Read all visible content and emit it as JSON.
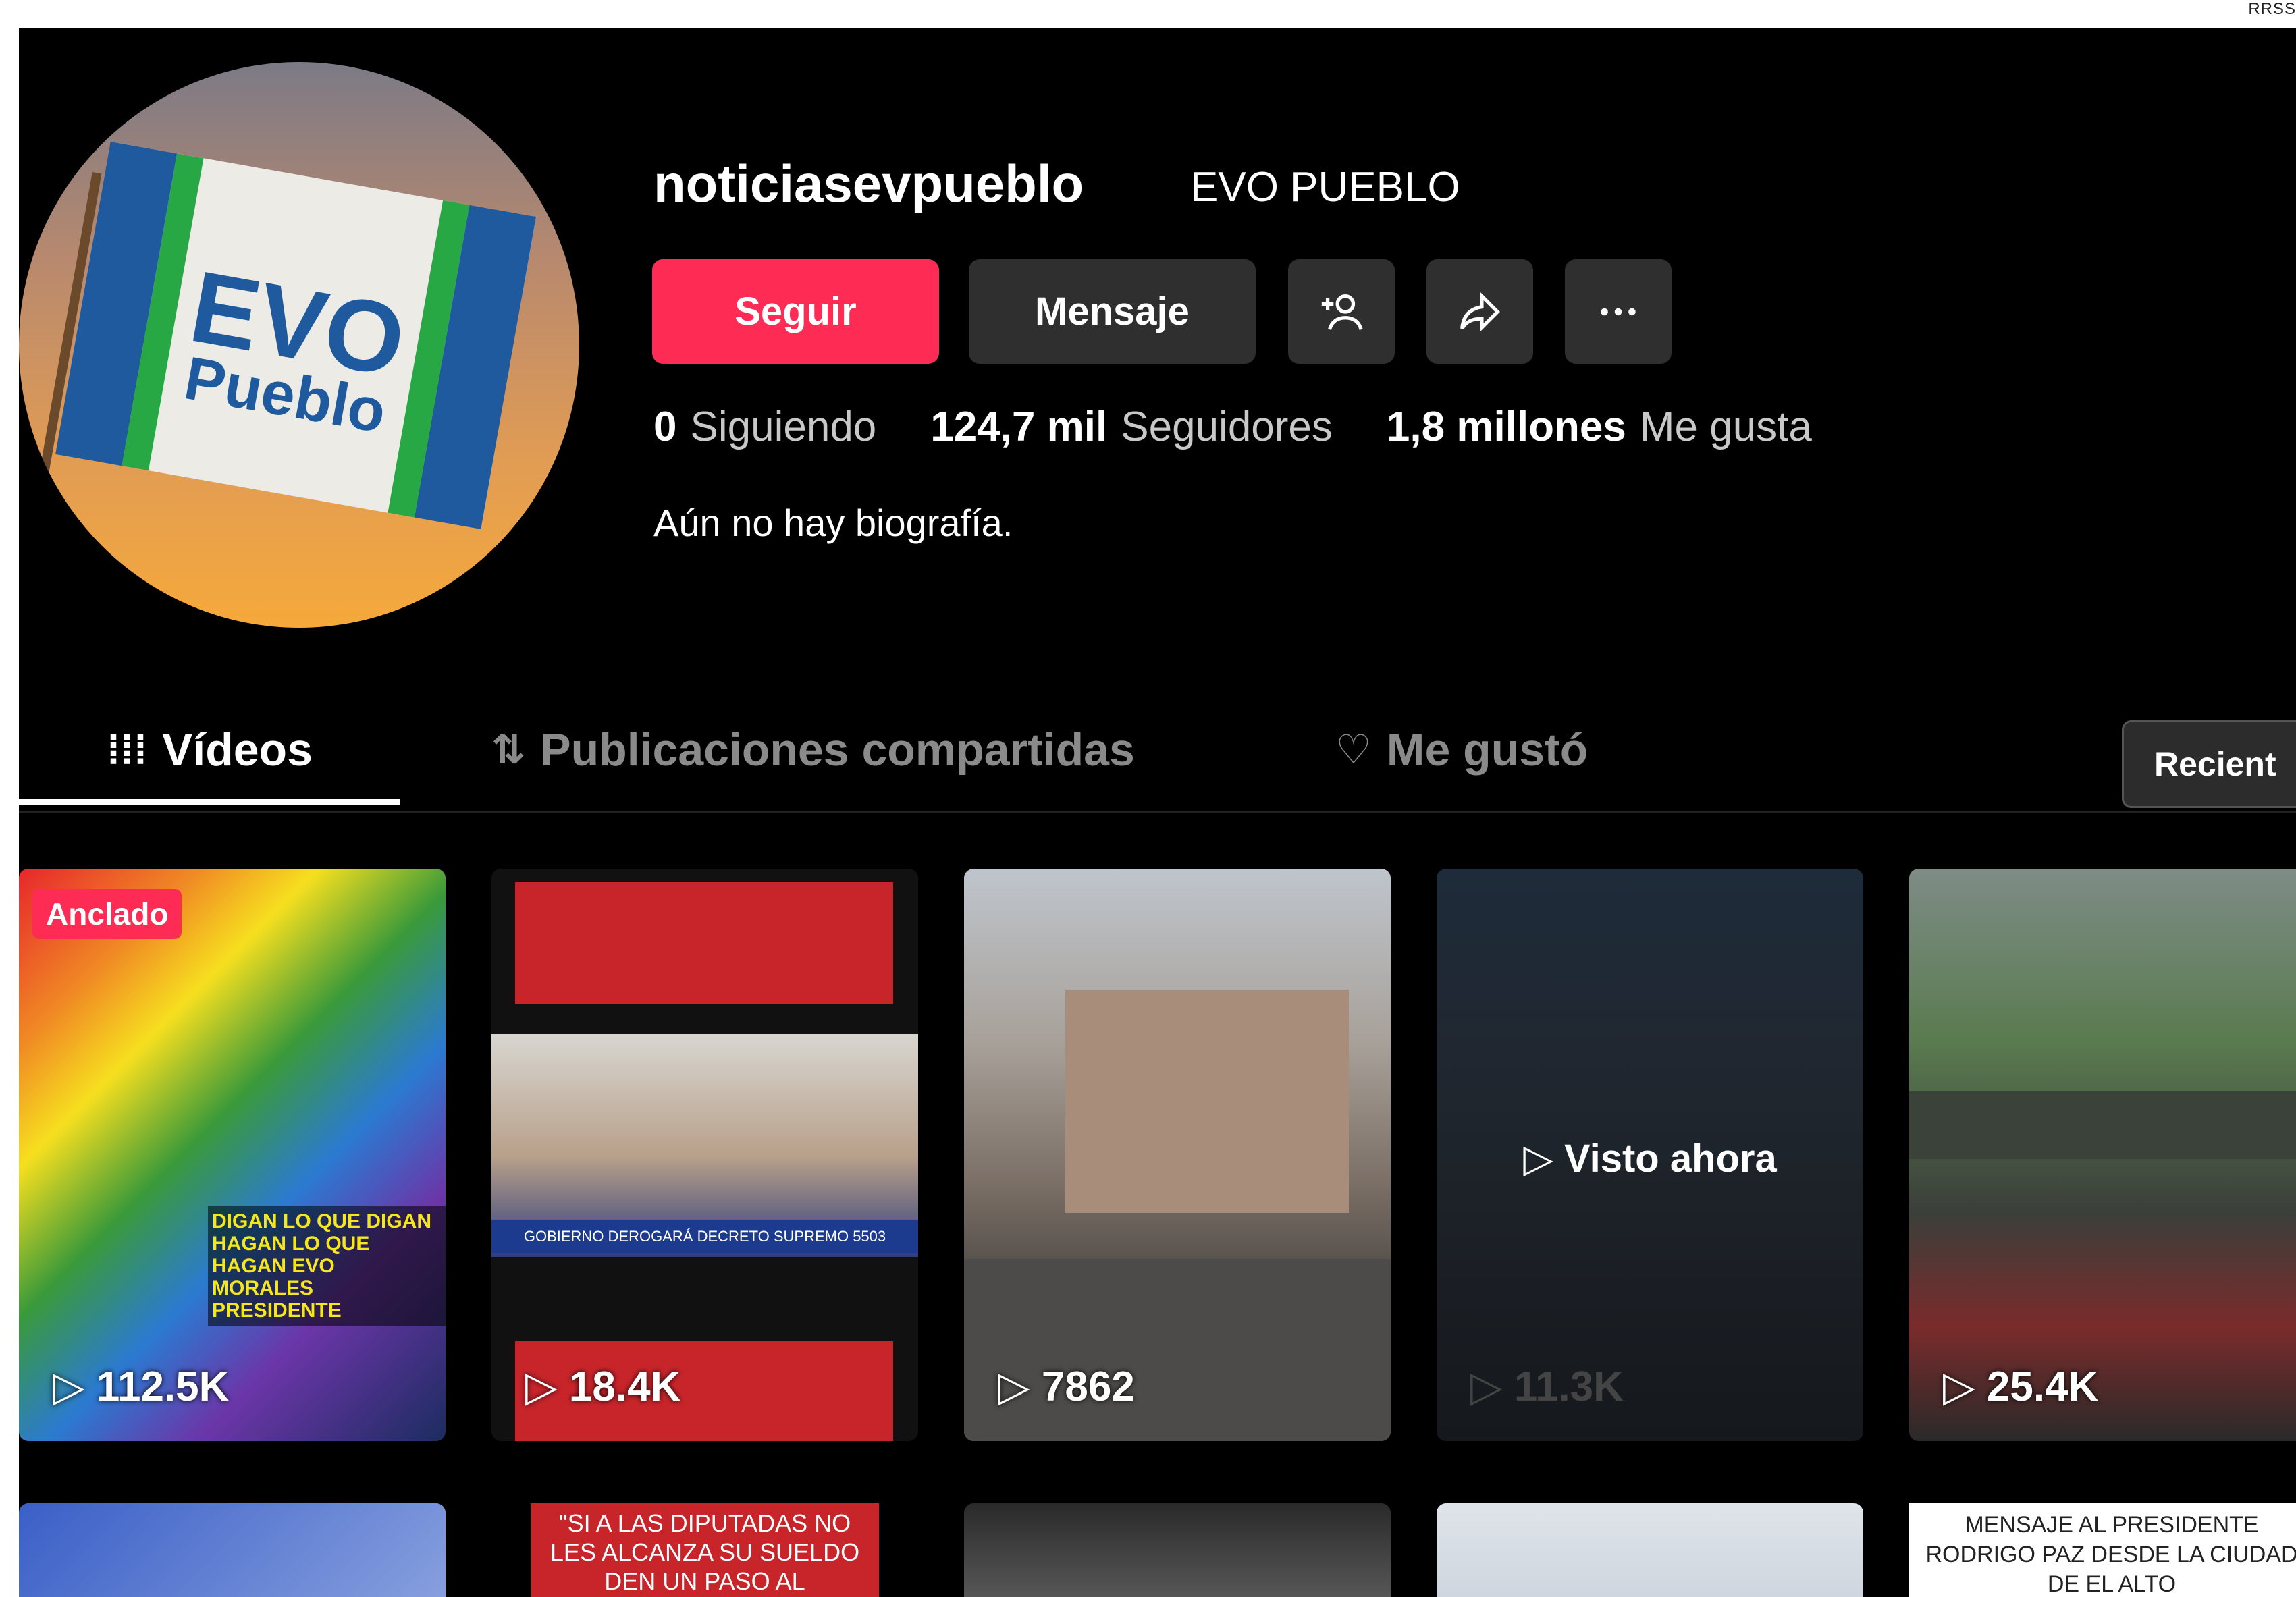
{
  "corner_label": "RRSS",
  "profile": {
    "username": "noticiasevpueblo",
    "nickname": "EVO PUEBLO",
    "avatar_text_1": "EVO",
    "avatar_text_2": "Pueblo",
    "follow_label": "Seguir",
    "message_label": "Mensaje",
    "stats": {
      "following_count": "0",
      "following_label": "Siguiendo",
      "followers_count": "124,7 mil",
      "followers_label": "Seguidores",
      "likes_count": "1,8 millones",
      "likes_label": "Me gusta"
    },
    "bio": "Aún no hay biografía."
  },
  "tabs": {
    "videos": "Vídeos",
    "shared": "Publicaciones compartidas",
    "liked": "Me gustó",
    "sort": "Recient"
  },
  "videos": [
    {
      "badge": "Anclado",
      "views": "112.5K",
      "overlay": "DIGAN LO QUE DIGAN HAGAN LO QUE HAGAN EVO MORALES PRESIDENTE"
    },
    {
      "views": "18.4K",
      "tv_caption": "GOBIERNO DEROGARÁ DECRETO SUPREMO 5503"
    },
    {
      "views": "7862"
    },
    {
      "views": "11.3K",
      "watched": "Visto ahora"
    },
    {
      "views": "25.4K"
    }
  ],
  "row2": {
    "card2_text": "\"SI A LAS DIPUTADAS NO LES ALCANZA SU SUELDO DEN UN PASO AL",
    "card5_text": "MENSAJE AL PRESIDENTE RODRIGO PAZ DESDE LA CIUDAD DE EL ALTO"
  },
  "colors": {
    "accent": "#fe2c55",
    "button_dark": "#2f2f2f",
    "background": "#000000"
  }
}
